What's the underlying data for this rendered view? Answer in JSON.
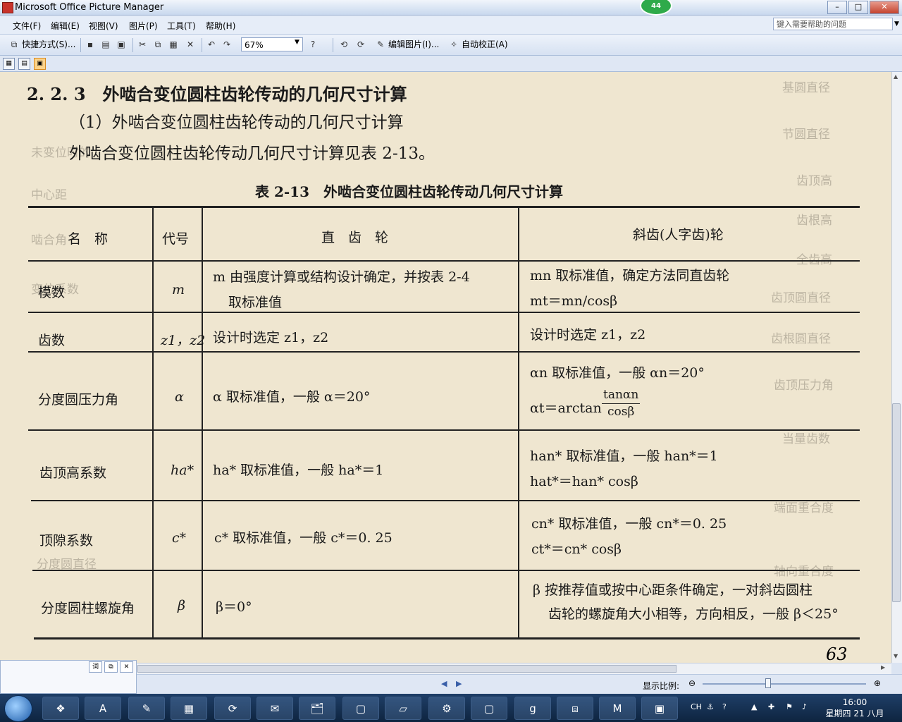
{
  "window": {
    "title": "Microsoft Office Picture Manager",
    "badge": "44",
    "min": "–",
    "max": "□",
    "close": "✕"
  },
  "menu": [
    "文件(F)",
    "编辑(E)",
    "视图(V)",
    "图片(P)",
    "工具(T)",
    "帮助(H)"
  ],
  "help_placeholder": "键入需要帮助的问题",
  "toolbar": {
    "shortcuts": "快捷方式(S)...",
    "zoom": "67%",
    "edit_picture": "编辑图片(I)...",
    "auto_correct": "自动校正(A)"
  },
  "document": {
    "heading": "2. 2. 3　外啮合变位圆柱齿轮传动的几何尺寸计算",
    "subheading": "（1）外啮合变位圆柱齿轮传动的几何尺寸计算",
    "paragraph": "外啮合变位圆柱齿轮传动几何尺寸计算见表 2-13。",
    "table_caption": "表 2-13　外啮合变位圆柱齿轮传动几何尺寸计算",
    "headers": [
      "名　称",
      "代号",
      "直　齿　轮",
      "斜齿(人字齿)轮"
    ],
    "rows": [
      {
        "name": "模数",
        "code": "m",
        "spur": [
          "m 由强度计算或结构设计确定，并按表 2-4",
          "取标准值"
        ],
        "helical": [
          "mn 取标准值，确定方法同直齿轮",
          "mt＝mn/cosβ"
        ]
      },
      {
        "name": "齿数",
        "code": "z1，z2",
        "spur": [
          "设计时选定 z1，z2"
        ],
        "helical": [
          "设计时选定 z1，z2"
        ]
      },
      {
        "name": "分度圆压力角",
        "code": "α",
        "spur": [
          "α 取标准值，一般 α＝20°"
        ],
        "helical": [
          "αn 取标准值，一般 αn＝20°",
          "αt＝arctan",
          "tanαn",
          "cosβ"
        ]
      },
      {
        "name": "齿顶高系数",
        "code": "ha*",
        "spur": [
          "ha* 取标准值，一般 ha*＝1"
        ],
        "helical": [
          "han* 取标准值，一般 han*＝1",
          "hat*＝han* cosβ"
        ]
      },
      {
        "name": "顶隙系数",
        "code": "c*",
        "spur": [
          "c* 取标准值，一般 c*＝0. 25"
        ],
        "helical": [
          "cn* 取标准值，一般 cn*＝0. 25",
          "ct*＝cn* cosβ"
        ]
      },
      {
        "name": "分度圆柱螺旋角",
        "code": "β",
        "spur": [
          "β＝0°"
        ],
        "helical": [
          "β 按推荐值或按中心距条件确定，一对斜齿圆柱",
          "齿轮的螺旋角大小相等，方向相反，一般 β＜25°"
        ]
      }
    ],
    "page_number": "63",
    "bleed_through": [
      "基圆直径",
      "节圆直径",
      "齿顶高",
      "齿根高",
      "全齿高",
      "齿顶圆直径",
      "齿根圆直径",
      "中心距",
      "啮合角",
      "变位系数",
      "未变位时的",
      "齿顶压力角",
      "当量齿数",
      "端面重合度",
      "分度圆直径",
      "轴向重合度"
    ]
  },
  "left_panel_tabs": [
    "词",
    "⧉",
    "✕"
  ],
  "status": {
    "zoom_label": "显示比例:",
    "zoom_level": 0.4
  },
  "taskbar": {
    "items": [
      "❖",
      "A",
      "✎",
      "▦",
      "⟳",
      "✉",
      "🗂",
      "▢",
      "▱",
      "⚙",
      "▢",
      "g",
      "⧈",
      "M",
      "▣"
    ],
    "tray_lang": "CH",
    "time": "16:00",
    "date": "星期四 21 八月"
  }
}
